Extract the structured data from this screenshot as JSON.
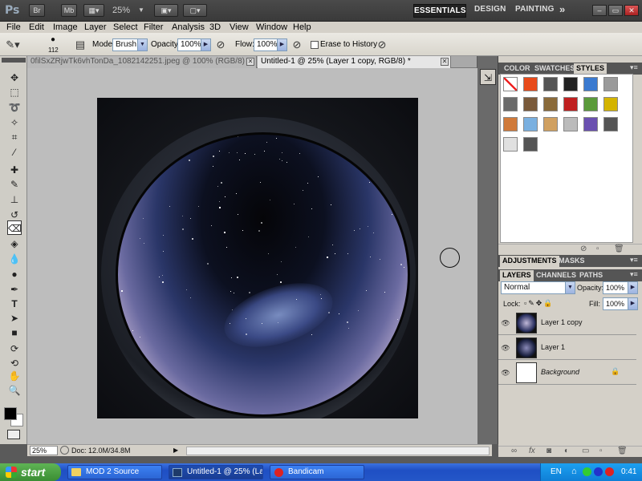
{
  "app": {
    "logo": "Ps",
    "btn_bridge": "Br",
    "btn_mini_bridge": "Mb",
    "zoom": "25%",
    "workspaces": [
      "ESSENTIALS",
      "DESIGN",
      "PAINTING"
    ],
    "more": "»",
    "win_min": "–",
    "win_max": "▭",
    "win_close": "✕"
  },
  "menu": [
    "File",
    "Edit",
    "Image",
    "Layer",
    "Select",
    "Filter",
    "Analysis",
    "3D",
    "View",
    "Window",
    "Help"
  ],
  "options": {
    "brush_size": "112",
    "mode_label": "Mode:",
    "mode_value": "Brush",
    "opacity_label": "Opacity:",
    "opacity_value": "100%",
    "flow_label": "Flow:",
    "flow_value": "100%",
    "erase_label": "Erase to History"
  },
  "tabs": [
    {
      "label": "0filSxZRjwTk6vhTonDa_1082142251.jpeg @ 100% (RGB/8)",
      "close": "✕"
    },
    {
      "label": "Untitled-1 @ 25% (Layer 1 copy, RGB/8) *",
      "close": "✕"
    }
  ],
  "status": {
    "zoom": "25%",
    "doc": "Doc: 12.0M/34.8M"
  },
  "panels": {
    "top_tabs": [
      "COLOR",
      "SWATCHES",
      "STYLES"
    ],
    "adj_tabs": [
      "ADJUSTMENTS",
      "MASKS"
    ],
    "layer_tabs": [
      "LAYERS",
      "CHANNELS",
      "PATHS"
    ],
    "blend_mode": "Normal",
    "opacity_label": "Opacity:",
    "opacity_value": "100%",
    "lock_label": "Lock:",
    "fill_label": "Fill:",
    "fill_value": "100%",
    "layers": [
      {
        "name": "Layer 1 copy",
        "selected": true
      },
      {
        "name": "Layer 1",
        "selected": false
      },
      {
        "name": "Background",
        "selected": false
      }
    ],
    "style_swatch_colors": [
      "#ffffff",
      "#e84a1a",
      "#555555",
      "#222222",
      "#3a7ad0",
      "#9a9a9a",
      "#6a6a6a",
      "#7a5a3a",
      "#8a6a3a",
      "#c02020",
      "#5a9a3a",
      "#d4b400",
      "#d07a3a",
      "#7ab0e0",
      "#d0a060",
      "#bbbbbb",
      "#6a50b0",
      "#555555",
      "#e0e0e0",
      "#555555"
    ]
  },
  "taskbar": {
    "start": "start",
    "tasks": [
      "MOD 2 Source",
      "Untitled-1 @ 25% (La...",
      "Bandicam"
    ],
    "lang": "EN",
    "clock": "0:41"
  }
}
